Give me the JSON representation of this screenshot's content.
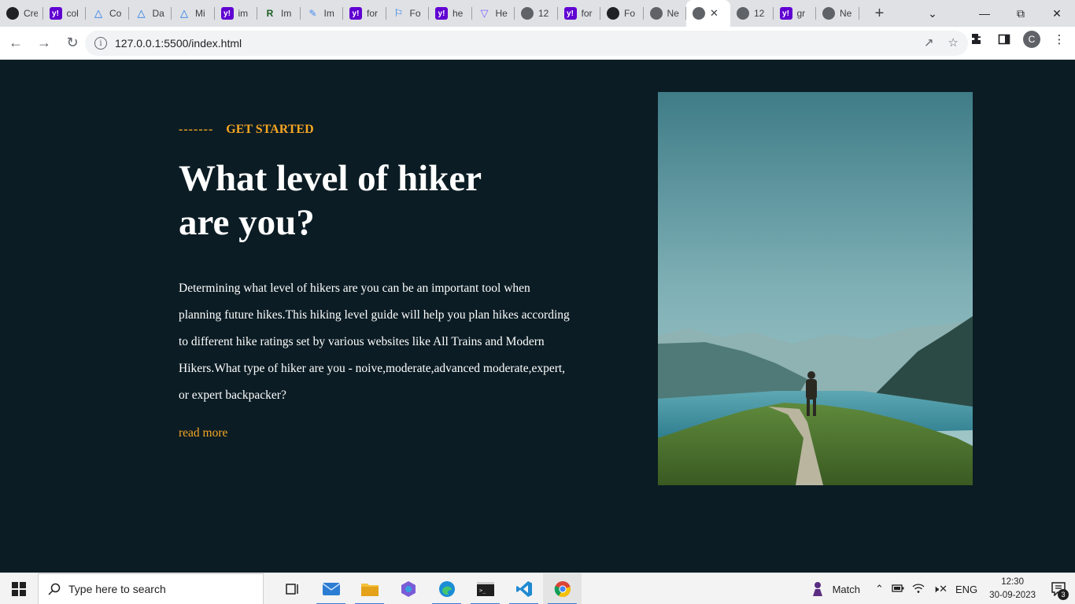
{
  "browser": {
    "tabs": [
      {
        "title": "Cre",
        "icon": "openai-icon"
      },
      {
        "title": "col",
        "icon": "yahoo-icon"
      },
      {
        "title": "Co",
        "icon": "triangle-icon"
      },
      {
        "title": "Da",
        "icon": "triangle-icon"
      },
      {
        "title": "Mi",
        "icon": "triangle-icon"
      },
      {
        "title": "im",
        "icon": "yahoo-icon"
      },
      {
        "title": "Im",
        "icon": "rr-icon"
      },
      {
        "title": "Im",
        "icon": "note-icon"
      },
      {
        "title": "for",
        "icon": "yahoo-icon"
      },
      {
        "title": "Fo",
        "icon": "flag-icon"
      },
      {
        "title": "he",
        "icon": "yahoo-icon"
      },
      {
        "title": "He",
        "icon": "shield-icon"
      },
      {
        "title": "12",
        "icon": "globe-icon"
      },
      {
        "title": "for",
        "icon": "yahoo-icon"
      },
      {
        "title": "Fo",
        "icon": "dark-icon"
      },
      {
        "title": "Ne",
        "icon": "globe-icon"
      },
      {
        "title": "",
        "icon": "globe-icon",
        "active": true
      },
      {
        "title": "12",
        "icon": "globe-icon"
      },
      {
        "title": "gr",
        "icon": "yahoo-icon"
      },
      {
        "title": "Ne",
        "icon": "globe-icon"
      }
    ],
    "url": "127.0.0.1:5500/index.html",
    "profile_initial": "C"
  },
  "page": {
    "kicker_dash": "-------",
    "kicker": "GET STARTED",
    "headline": "What level of hiker are you?",
    "description": "Determining what level of hikers are you can be an important tool when planning future hikes.This hiking level guide will help you plan hikes according to different hike ratings set by various websites like All Trains and Modern Hikers.What type of hiker are you - noive,moderate,advanced moderate,expert, or expert backpacker?",
    "read_more": "read more",
    "accent_color": "#f6a623",
    "background_color": "#0b1c24"
  },
  "taskbar": {
    "search_placeholder": "Type here to search",
    "weather_label": "Match",
    "language": "ENG",
    "time": "12:30",
    "date": "30-09-2023",
    "notification_count": "3"
  }
}
